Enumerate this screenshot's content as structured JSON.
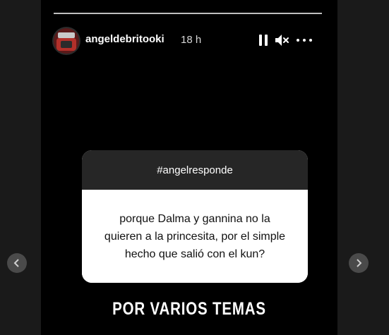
{
  "header": {
    "username": "angeldebritooki",
    "time": "18 h",
    "pause_icon": "pause-icon",
    "mute_icon": "mute-icon",
    "more_icon": "more-options-icon"
  },
  "progress": {
    "segments": 1,
    "fraction": 1.0
  },
  "question_card": {
    "title": "#angelresponde",
    "question": "porque Dalma y gannina no la quieren a la princesita, por el simple hecho que salió con el kun?"
  },
  "answer": {
    "text": "POR VARIOS TEMAS"
  },
  "navigation": {
    "prev_icon": "chevron-left-icon",
    "next_icon": "chevron-right-icon"
  },
  "colors": {
    "background": "#1a1a1a",
    "story": "#000000",
    "card_header": "#262626",
    "card_body": "#ffffff"
  }
}
